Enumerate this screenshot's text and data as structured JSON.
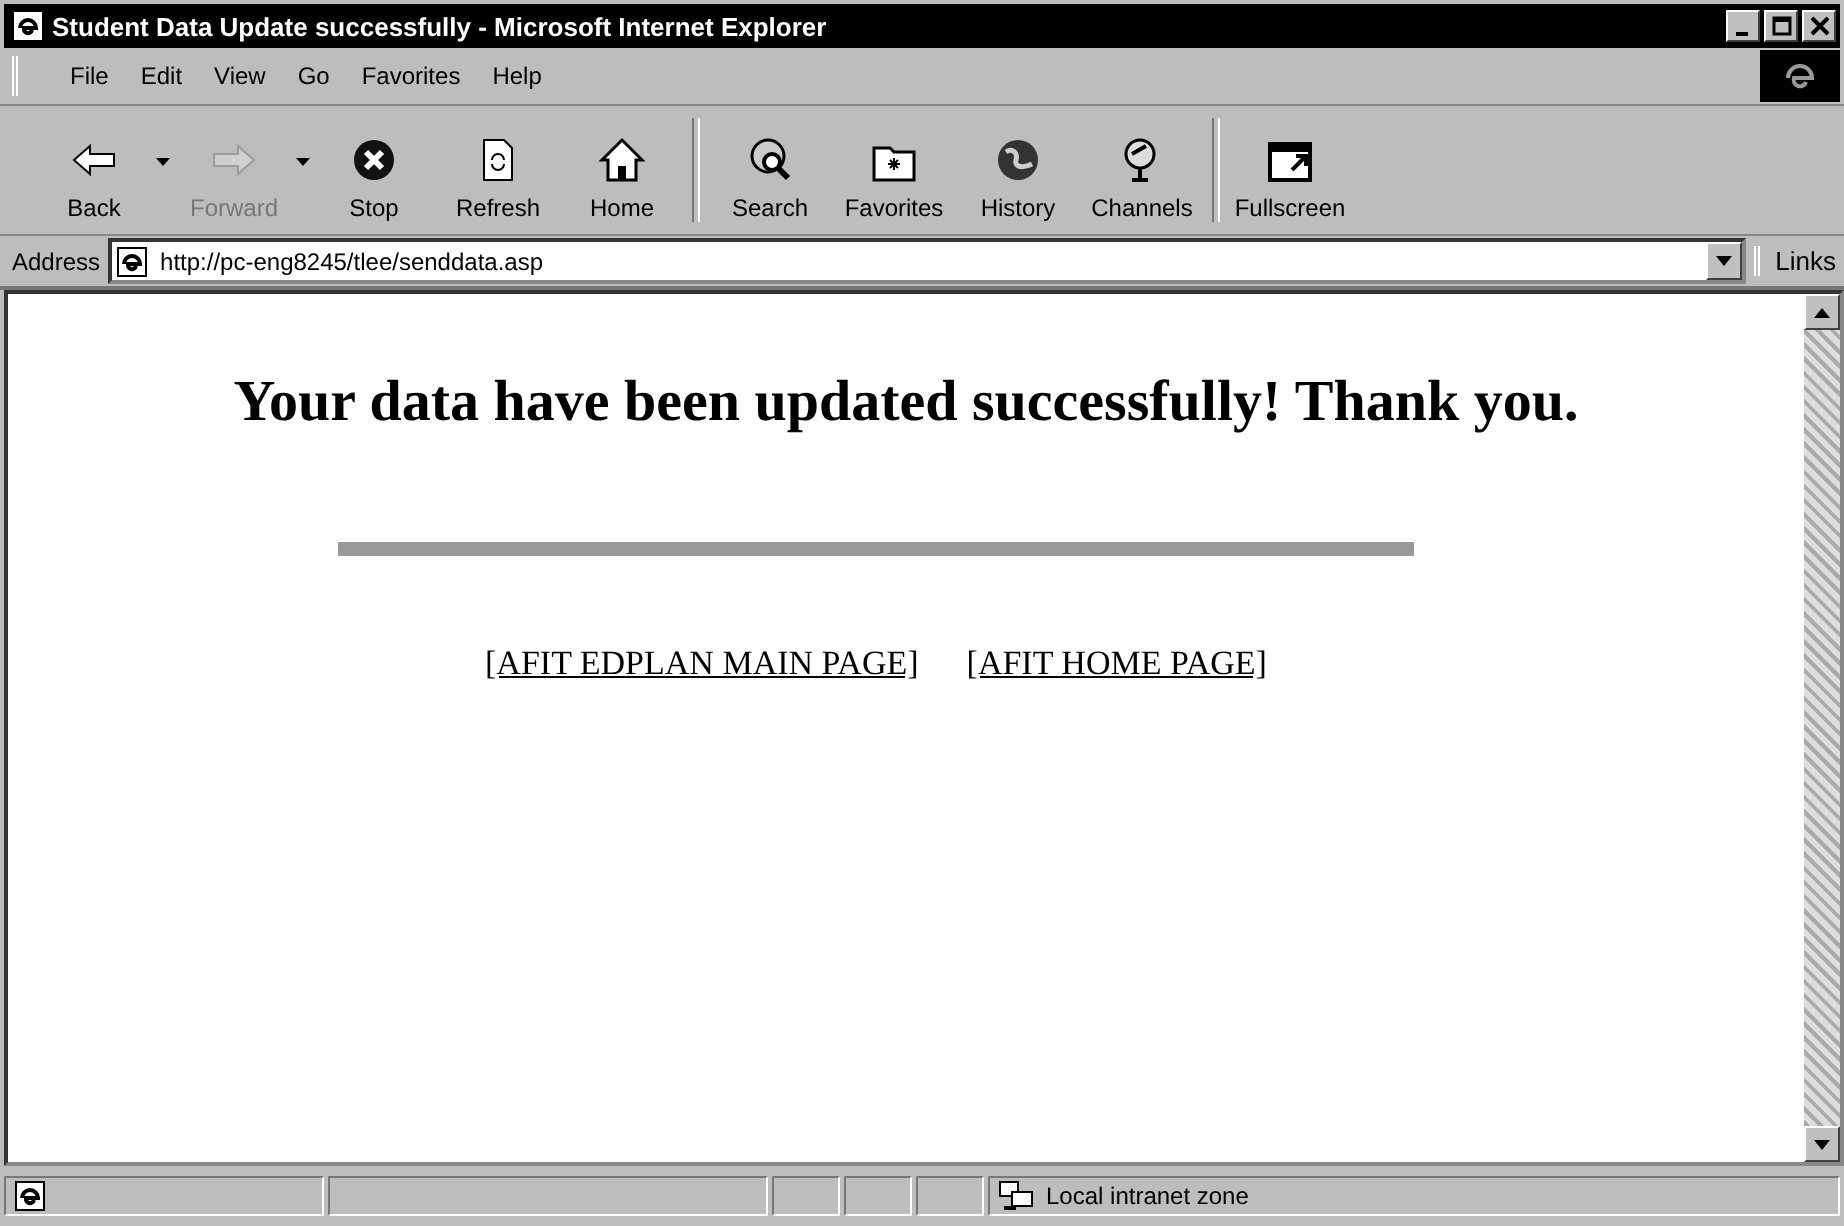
{
  "window": {
    "title": "Student Data Update successfully - Microsoft Internet Explorer"
  },
  "menu": [
    "File",
    "Edit",
    "View",
    "Go",
    "Favorites",
    "Help"
  ],
  "toolbar": [
    {
      "label": "Back",
      "disabled": false,
      "dropdown": true
    },
    {
      "label": "Forward",
      "disabled": true,
      "dropdown": true
    },
    {
      "label": "Stop",
      "disabled": false,
      "dropdown": false
    },
    {
      "label": "Refresh",
      "disabled": false,
      "dropdown": false
    },
    {
      "label": "Home",
      "disabled": false,
      "dropdown": false
    },
    {
      "label": "Search",
      "disabled": false,
      "dropdown": false
    },
    {
      "label": "Favorites",
      "disabled": false,
      "dropdown": false
    },
    {
      "label": "History",
      "disabled": false,
      "dropdown": false
    },
    {
      "label": "Channels",
      "disabled": false,
      "dropdown": false
    },
    {
      "label": "Fullscreen",
      "disabled": false,
      "dropdown": false
    }
  ],
  "address": {
    "label": "Address",
    "value": "http://pc-eng8245/tlee/senddata.asp",
    "links": "Links"
  },
  "content": {
    "heading": "Your data have been updated successfully! Thank you.",
    "links": [
      "[AFIT EDPLAN MAIN PAGE]",
      "[AFIT HOME PAGE]"
    ]
  },
  "status_bar": {
    "zone": "Local intranet zone"
  }
}
